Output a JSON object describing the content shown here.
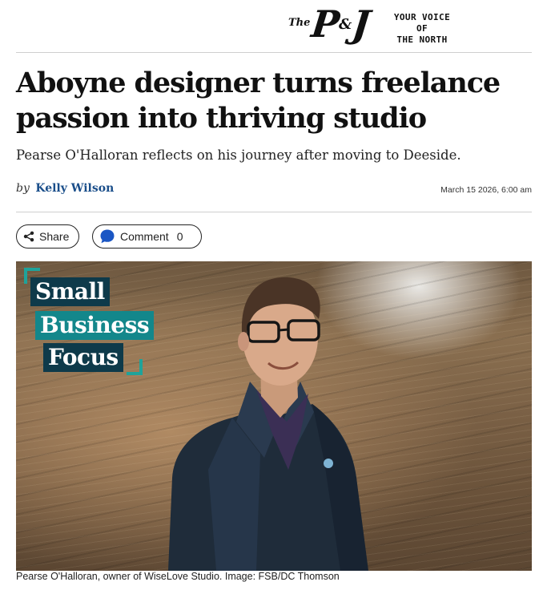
{
  "masthead": {
    "logo_the": "The",
    "logo_p": "P",
    "logo_amp": "&",
    "logo_j": "J",
    "tagline_line1": "YOUR VOICE OF",
    "tagline_line2": "THE NORTH"
  },
  "article": {
    "headline": "Aboyne designer turns freelance passion into thriving studio",
    "standfirst": "Pearse O'Halloran reflects on his journey after moving to Deeside.",
    "byline_prefix": "by",
    "author": "Kelly Wilson",
    "published": "March 15 2026, 6:00 am"
  },
  "actions": {
    "share_label": "Share",
    "comment_label": "Comment",
    "comment_count": "0"
  },
  "image": {
    "badge_line1": "Small",
    "badge_line2": "Business",
    "badge_line3": "Focus",
    "caption": "Pearse O'Halloran, owner of WiseLove Studio. Image: FSB/DC Thomson"
  },
  "colors": {
    "author_link": "#1a4e8a",
    "badge_dark": "#0e3a4a",
    "badge_teal": "#13878b",
    "comment_icon": "#1a56c4"
  },
  "icons": [
    "share-icon",
    "comment-icon"
  ]
}
